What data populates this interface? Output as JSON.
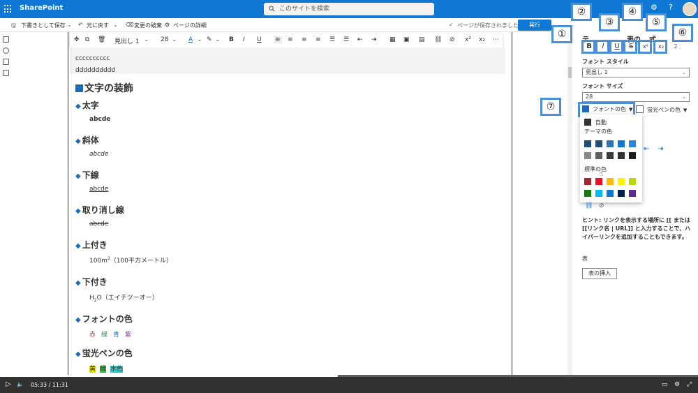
{
  "topbar": {
    "app_name": "SharePoint",
    "search_placeholder": "このサイトを検索",
    "settings_icon": "gear-icon",
    "help_label": "?"
  },
  "cmdbar": {
    "save_draft": "下書きとして保存",
    "undo": "元に戻す",
    "discard": "変更の破棄",
    "page_details": "ページの詳細",
    "saved_status": "ページが保存されました",
    "publish": "発行"
  },
  "format_toolbar": {
    "style": "見出し 1",
    "size": "28",
    "buttons": [
      "B",
      "I",
      "U"
    ],
    "superscript": "x²",
    "subscript": "x₂"
  },
  "content": {
    "line1": "cccccccccc",
    "line2": "dddddddddd",
    "h1": "文字の装飾",
    "sections": [
      {
        "heading": "太字",
        "body": "abcde"
      },
      {
        "heading": "斜体",
        "body": "abcde"
      },
      {
        "heading": "下線",
        "body": "abcde"
      },
      {
        "heading": "取り消し線",
        "body": "abcde"
      },
      {
        "heading": "上付き",
        "body_pre": "100m",
        "body_sup": "2",
        "body_post": "（100平方メートル）"
      },
      {
        "heading": "下付き",
        "body_pre": "H",
        "body_sub": "2",
        "body_post": "O（エイチツーオー）"
      },
      {
        "heading": "フォントの色",
        "colors": [
          {
            "label": "赤",
            "color": "#c0392b"
          },
          {
            "label": "緑",
            "color": "#2e8b57"
          },
          {
            "label": "青",
            "color": "#1d6bb5"
          },
          {
            "label": "紫",
            "color": "#7d3c98"
          }
        ]
      },
      {
        "heading": "蛍光ペンの色",
        "highlights": [
          {
            "label": "黄",
            "bg": "#e6e600"
          },
          {
            "label": "緑",
            "bg": "#33cc33"
          },
          {
            "label": "水色",
            "bg": "#33cccc"
          }
        ]
      }
    ]
  },
  "panel": {
    "title_partial": "テ",
    "title_partial2": "表の",
    "title_partial3": "式",
    "font_style_label": "フォント スタイル",
    "font_style_value": "見出し 1",
    "font_size_label": "フォント サイズ",
    "font_size_value": "28",
    "font_color_label": "フォントの色",
    "highlight_label": "蛍光ペンの色",
    "hint": "ヒント: リンクを表示する場所に [[ または [[リンク名 | URL]] と入力することで、ハイパーリンクを追加することもできます。",
    "table_label": "表",
    "insert_table": "表の挿入",
    "sub_small": "x₂",
    "extra_small": "2"
  },
  "color_dropdown": {
    "auto": "自動",
    "theme_label": "テーマの色",
    "standard_label": "標準の色",
    "theme_row1": [
      "#1f4e79",
      "#1f4e79",
      "#2e75b6",
      "#0f78d4",
      "#2b88d8"
    ],
    "theme_row2": [
      "#8a8886",
      "#605e5c",
      "#3b3a39",
      "#323130",
      "#201f1e"
    ],
    "standard_row1": [
      "#a4262c",
      "#e81123",
      "#ffb900",
      "#fff100",
      "#bad80a"
    ],
    "standard_row2": [
      "#107c10",
      "#00bcf2",
      "#0f78d4",
      "#002050",
      "#5c2d91"
    ]
  },
  "callouts": [
    "①",
    "②",
    "③",
    "④",
    "⑤",
    "⑥",
    "⑦"
  ],
  "player": {
    "time": "05:33 / 11:31",
    "progress": 0.48
  }
}
